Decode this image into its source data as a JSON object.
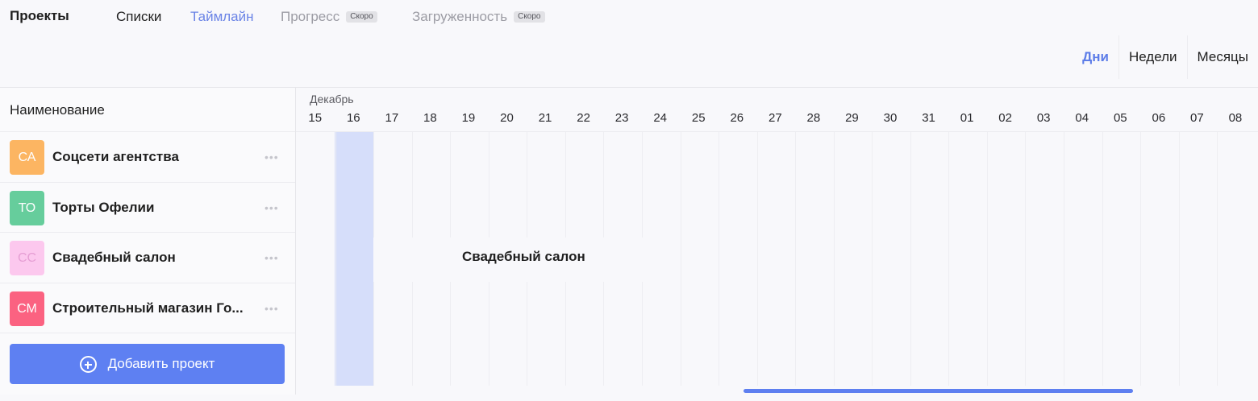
{
  "nav": {
    "title": "Проекты",
    "items": [
      {
        "label": "Списки",
        "state": "normal"
      },
      {
        "label": "Таймлайн",
        "state": "active"
      },
      {
        "label": "Прогресс",
        "state": "disabled",
        "badge": "Скоро"
      },
      {
        "label": "Загруженность",
        "state": "disabled",
        "badge": "Скоро"
      }
    ]
  },
  "scale": {
    "options": [
      "Дни",
      "Недели",
      "Месяцы"
    ],
    "selected": "Дни"
  },
  "sidebar": {
    "column_header": "Наименование",
    "projects": [
      {
        "initials": "СА",
        "name": "Соцсети агентства",
        "color": "#fdb25a"
      },
      {
        "initials": "ТО",
        "name": "Торты Офелии",
        "color": "#5fcb97"
      },
      {
        "initials": "СС",
        "name": "Свадебный салон",
        "color": "#fdc6ee",
        "initials_color": "#e59ad2"
      },
      {
        "initials": "СМ",
        "name": "Строительный магазин Го...",
        "color": "#fc5a7b"
      }
    ],
    "add_button": "Добавить проект"
  },
  "timeline": {
    "month": "Декабрь",
    "days": [
      "15",
      "16",
      "17",
      "18",
      "19",
      "20",
      "21",
      "22",
      "23",
      "24",
      "25",
      "26",
      "27",
      "28",
      "29",
      "30",
      "31",
      "01",
      "02",
      "03",
      "04",
      "05",
      "06",
      "07",
      "08"
    ],
    "today": "16",
    "bar_label": "Свадебный салон",
    "accent": "#5e80f2"
  }
}
